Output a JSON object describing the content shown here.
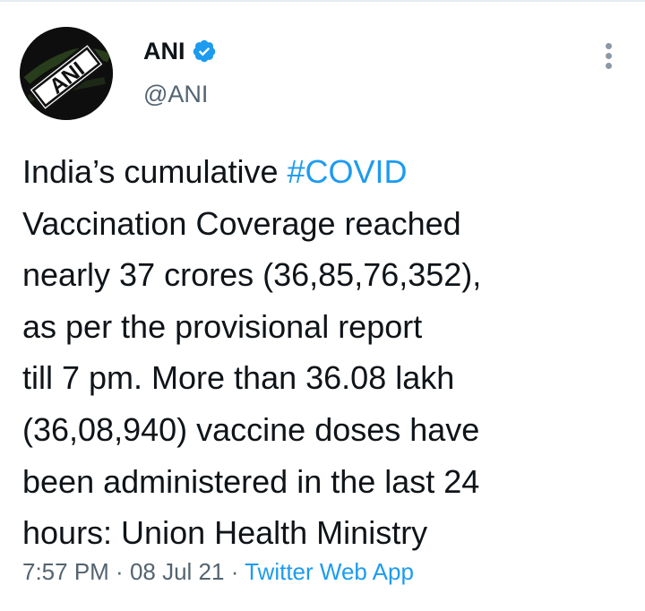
{
  "author": {
    "display_name": "ANI",
    "handle": "@ANI",
    "avatar_text": "ANI",
    "verified": true
  },
  "tweet": {
    "lines": [
      {
        "text": "India’s cumulative ",
        "hashtag": "#COVID"
      },
      {
        "text": "Vaccination Coverage reached"
      },
      {
        "text": "nearly 37 crores (36,85,76,352),"
      },
      {
        "text": "as per the provisional report"
      },
      {
        "text": "till 7 pm. More than 36.08 lakh"
      },
      {
        "text": "(36,08,940) vaccine doses have"
      },
      {
        "text": "been administered in the last 24"
      },
      {
        "text": "hours: Union Health Ministry"
      }
    ]
  },
  "meta": {
    "time": "7:57 PM",
    "separator": " · ",
    "date": "08 Jul 21",
    "source": "Twitter Web App"
  },
  "colors": {
    "link": "#1d9bf0",
    "muted": "#536471",
    "text": "#0f1419"
  },
  "icons": {
    "verified": "verified-badge-icon",
    "more": "more-options-icon"
  }
}
